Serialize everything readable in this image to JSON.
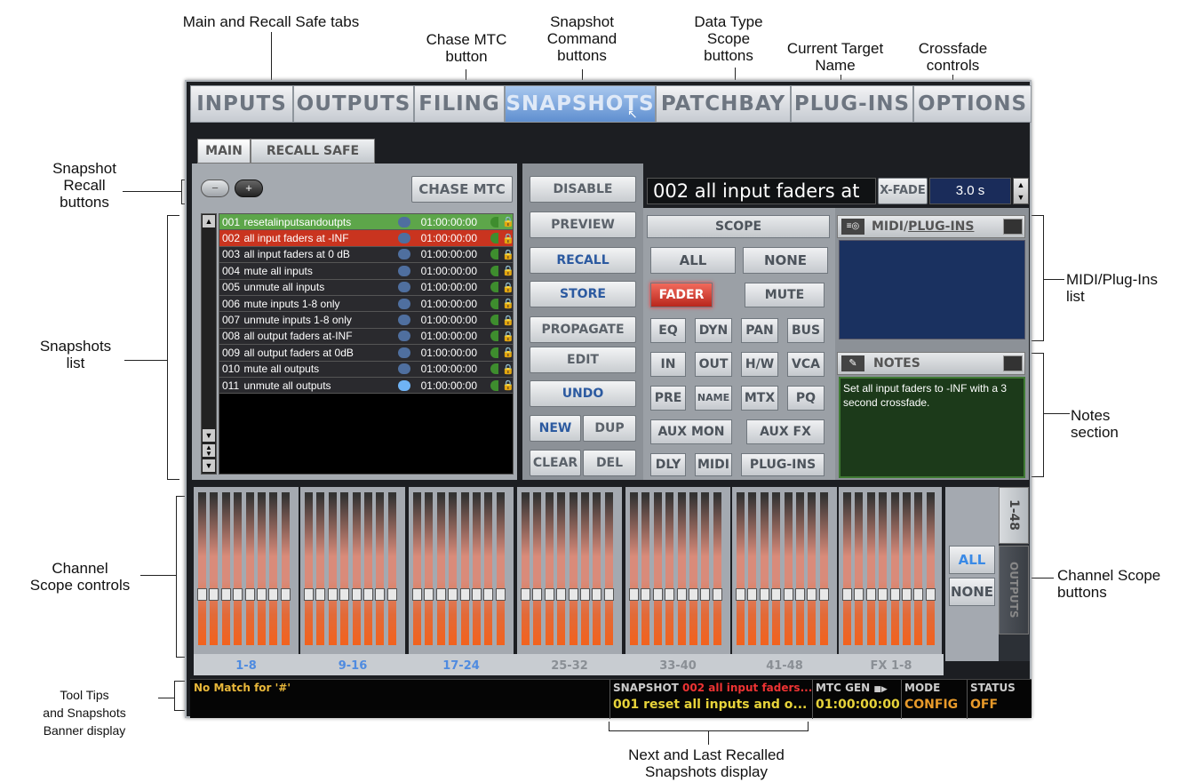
{
  "annotations": {
    "main_recall_tabs": "Main and Recall Safe tabs",
    "chase_mtc_l1": "Chase MTC",
    "chase_mtc_l2": "button",
    "snap_cmd_l1": "Snapshot",
    "snap_cmd_l2": "Command",
    "snap_cmd_l3": "buttons",
    "data_type_l1": "Data Type",
    "data_type_l2": "Scope",
    "data_type_l3": "buttons",
    "target_l1": "Current Target",
    "target_l2": "Name",
    "xfade_l1": "Crossfade",
    "xfade_l2": "controls",
    "recall_btns_l1": "Snapshot",
    "recall_btns_l2": "Recall",
    "recall_btns_l3": "buttons",
    "snap_list_l1": "Snapshots",
    "snap_list_l2": "list",
    "midi_list_l1": "MIDI/Plug-Ins",
    "midi_list_l2": "list",
    "notes_l1": "Notes",
    "notes_l2": "section",
    "chan_scope_ctrl_l1": "Channel",
    "chan_scope_ctrl_l2": "Scope controls",
    "chan_scope_btn_l1": "Channel Scope",
    "chan_scope_btn_l2": "buttons",
    "tooltips_l1": "Tool Tips",
    "tooltips_l2": "and Snapshots",
    "tooltips_l3": "Banner display",
    "next_last_l1": "Next and Last Recalled",
    "next_last_l2": "Snapshots display"
  },
  "top_tabs": [
    "INPUTS",
    "OUTPUTS",
    "FILING",
    "SNAPSHOTS",
    "PATCHBAY",
    "PLUG-INS",
    "OPTIONS"
  ],
  "sub_tabs": {
    "main": "MAIN",
    "recall_safe": "RECALL SAFE"
  },
  "chase_mtc": "CHASE MTC",
  "snapshots": [
    {
      "num": "001",
      "name": "resetalinputsandoutpts",
      "time": "01:00:00:00"
    },
    {
      "num": "002",
      "name": "all input faders at -INF",
      "time": "01:00:00:00"
    },
    {
      "num": "003",
      "name": "all input faders at 0 dB",
      "time": "01:00:00:00"
    },
    {
      "num": "004",
      "name": "mute all inputs",
      "time": "01:00:00:00"
    },
    {
      "num": "005",
      "name": "unmute all inputs",
      "time": "01:00:00:00"
    },
    {
      "num": "006",
      "name": "mute inputs 1-8 only",
      "time": "01:00:00:00"
    },
    {
      "num": "007",
      "name": "unmute inputs 1-8 only",
      "time": "01:00:00:00"
    },
    {
      "num": "008",
      "name": "all output faders at-INF",
      "time": "01:00:00:00"
    },
    {
      "num": "009",
      "name": "all output faders at 0dB",
      "time": "01:00:00:00"
    },
    {
      "num": "010",
      "name": "mute all outputs",
      "time": "01:00:00:00"
    },
    {
      "num": "011",
      "name": "unmute all outputs",
      "time": "01:00:00:00"
    }
  ],
  "commands": {
    "disable": "DISABLE",
    "preview": "PREVIEW",
    "recall": "RECALL",
    "store": "STORE",
    "propagate": "PROPAGATE",
    "edit": "EDIT",
    "undo": "UNDO",
    "new": "NEW",
    "dup": "DUP",
    "clear": "CLEAR",
    "del": "DEL"
  },
  "target_name": "002 all input faders at",
  "xfade_label": "X-FADE",
  "xfade_value": "3.0 s",
  "scope": {
    "title": "SCOPE",
    "all": "ALL",
    "none": "NONE",
    "fader": "FADER",
    "mute": "MUTE",
    "eq": "EQ",
    "dyn": "DYN",
    "pan": "PAN",
    "bus": "BUS",
    "in": "IN",
    "out": "OUT",
    "hw": "H/W",
    "vca": "VCA",
    "pre": "PRE",
    "name": "NAME",
    "mtx": "MTX",
    "pq": "PQ",
    "auxmon": "AUX MON",
    "auxfx": "AUX FX",
    "dly": "DLY",
    "midi": "MIDI",
    "plugins": "PLUG-INS"
  },
  "midi_plugins_title_a": "MIDI/",
  "midi_plugins_title_b": "PLUG-INS",
  "notes_title": "NOTES",
  "notes_text": "Set all input faders to -INF with a 3 second crossfade.",
  "channel_groups": [
    "1-8",
    "9-16",
    "17-24",
    "25-32",
    "33-40",
    "41-48",
    "FX 1-8"
  ],
  "side_tabs": {
    "inputs_range": "1-48",
    "outputs": "OUTPUTS"
  },
  "channel_scope": {
    "all": "ALL",
    "none": "NONE"
  },
  "status_bar": {
    "tooltip": "No Match for '#'",
    "snapshot_label": "SNAPSHOT",
    "next_snapshot": "002 all input faders...",
    "last_snapshot": "001 reset all inputs and o...",
    "mtc_label": "MTC GEN",
    "mtc_value": "01:00:00:00",
    "mode_label": "MODE",
    "mode_value": "CONFIG",
    "status_label": "STATUS",
    "status_value": "OFF"
  }
}
